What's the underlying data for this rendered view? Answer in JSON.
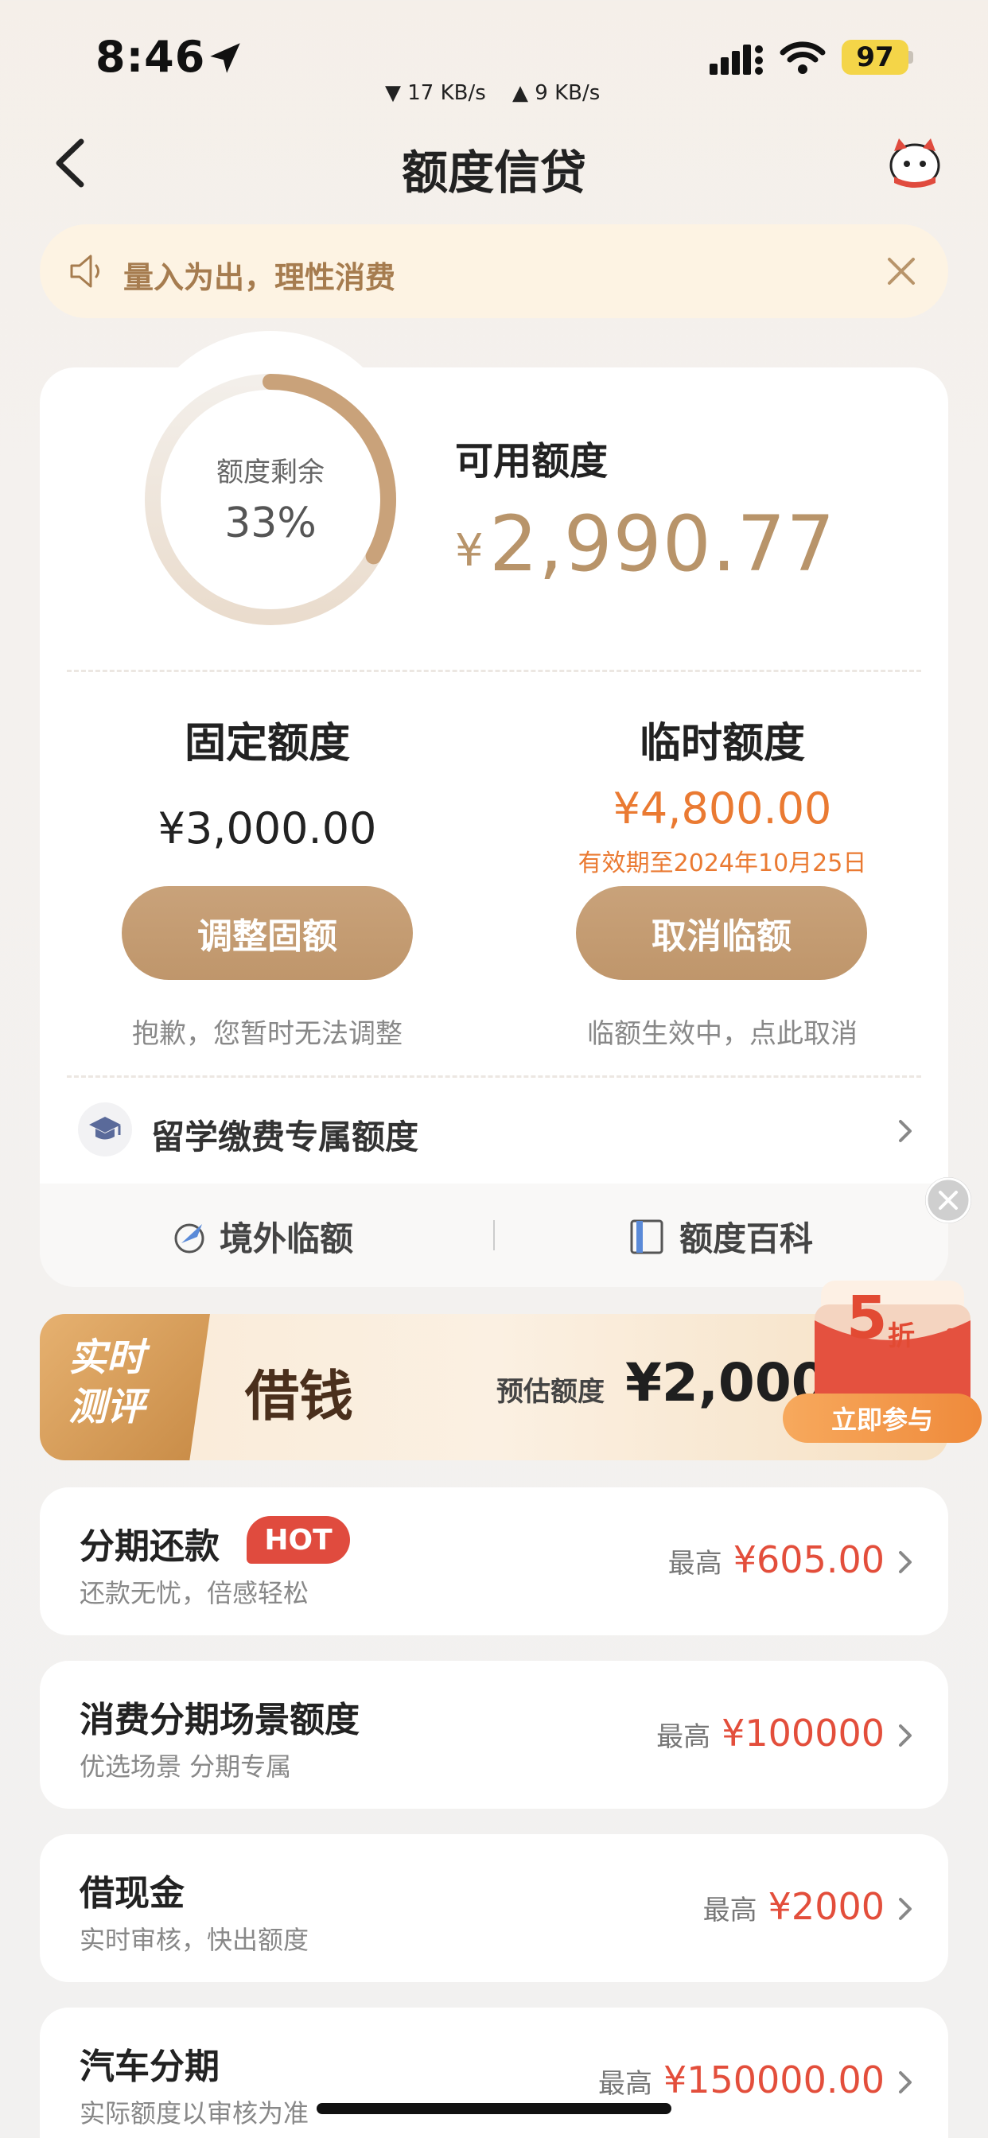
{
  "status_bar": {
    "time": "8:46",
    "download": "▼ 17 KB/s",
    "upload": "▲ 9 KB/s",
    "battery": "97"
  },
  "header": {
    "title": "额度信贷",
    "back_icon": "chevron-left-icon",
    "mascot_icon": "mascot-icon"
  },
  "notice": {
    "text": "量入为出，理性消费",
    "icon": "speaker-icon"
  },
  "limit": {
    "ring_label": "额度剩余",
    "ring_percent": "33%",
    "ring_fraction": 0.33,
    "available_label": "可用额度",
    "currency": "¥",
    "available_value": "2,990.77"
  },
  "fixed": {
    "title": "固定额度",
    "amount": "¥3,000.00",
    "button": "调整固额",
    "hint": "抱歉，您暂时无法调整"
  },
  "temporary": {
    "title": "临时额度",
    "amount": "¥4,800.00",
    "expire": "有效期至2024年10月25日",
    "button": "取消临额",
    "hint": "临额生效中，点此取消"
  },
  "study": {
    "label": "留学缴费专属额度"
  },
  "tools": {
    "overseas": "境外临额",
    "encyclopedia": "额度百科"
  },
  "promo": {
    "tag_line1": "实时",
    "tag_line2": "测评",
    "title": "借钱",
    "estimate_label": "预估额度",
    "estimate_value": "¥2,000",
    "discount_number": "5",
    "discount_unit": "折",
    "join_button": "立即参与"
  },
  "items": [
    {
      "title": "分期还款",
      "badge": "HOT",
      "subtitle": "还款无忧，倍感轻松",
      "max_label": "最高",
      "max_value": "¥605.00"
    },
    {
      "title": "消费分期场景额度",
      "subtitle": "优选场景 分期专属",
      "max_label": "最高",
      "max_value": "¥100000"
    },
    {
      "title": "借现金",
      "subtitle": "实时审核，快出额度",
      "max_label": "最高",
      "max_value": "¥2000"
    },
    {
      "title": "汽车分期",
      "subtitle": "实际额度以审核为准",
      "max_label": "最高",
      "max_value": "¥150000.00"
    }
  ],
  "colors": {
    "gold": "#b8946a",
    "button": "#c49c70",
    "orange": "#ea7a32",
    "red": "#e34e3b"
  }
}
